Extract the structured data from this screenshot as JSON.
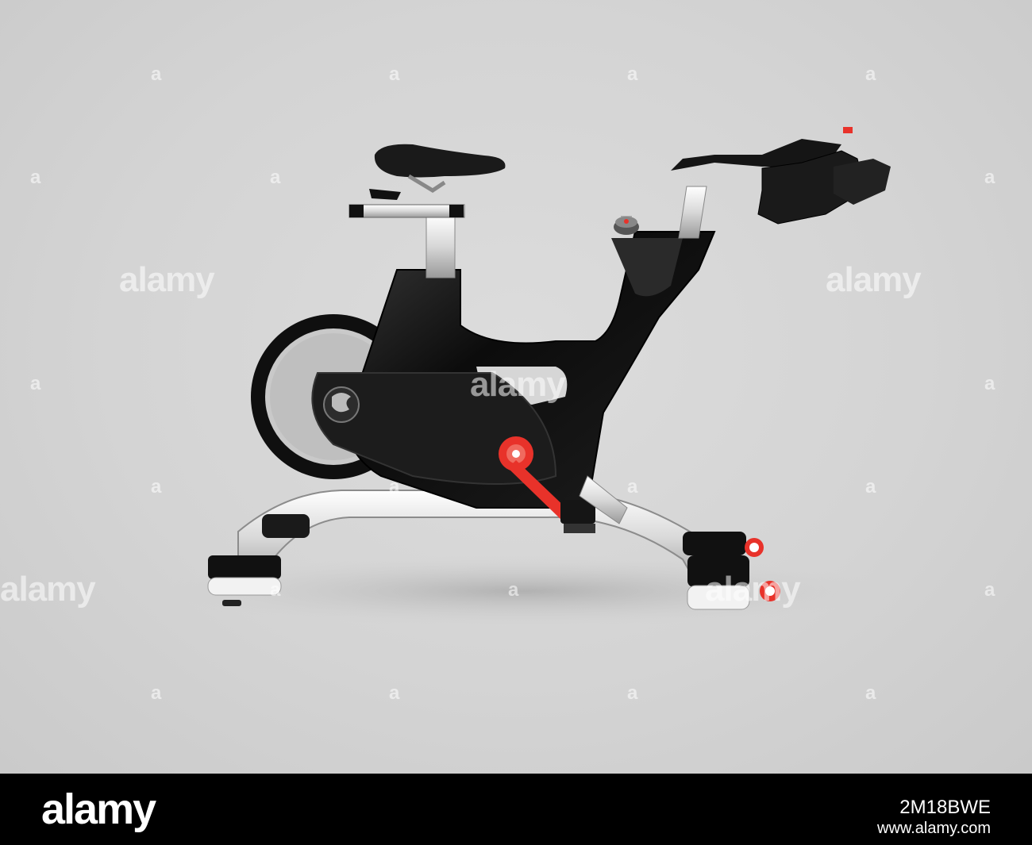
{
  "watermark": {
    "large_text": "alamy",
    "small_text": "a"
  },
  "footer": {
    "brand": "alamy",
    "image_id": "2M18BWE",
    "url": "www.alamy.com"
  },
  "colors": {
    "background": "#d6d6d6",
    "frame": "#111111",
    "accent": "#e8322a",
    "footer": "#000000"
  }
}
